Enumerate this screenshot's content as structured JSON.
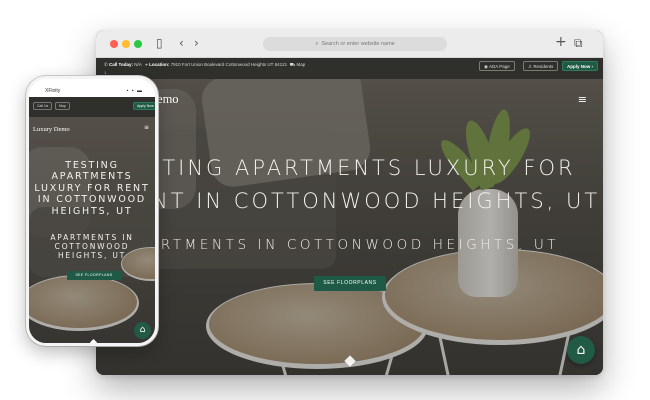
{
  "browser": {
    "url_placeholder": "Search or enter website name",
    "icons": {
      "sidebar": "sidebar-icon",
      "back": "chevron-left-icon",
      "forward": "chevron-right-icon",
      "new_tab": "plus-icon",
      "tabs": "tabs-icon",
      "search": "search-icon"
    }
  },
  "topbar": {
    "call_label": "Call Today:",
    "call_value": "N/A",
    "location_label": "Location:",
    "location_value": "7910 Fort Union Boulevard Cottonwood Heights UT 84121",
    "map_link": "Map",
    "sub_text": "1",
    "buttons": {
      "ada": "ADA Page",
      "residents": "Residents",
      "apply": "Apply Now"
    }
  },
  "site": {
    "logo": "Demo",
    "phone_logo": "Luxury Demo",
    "menu_icon": "≡",
    "title_line1": "STING APARTMENTS LUXURY FOR",
    "title_line2": "NT IN COTTONWOOD HEIGHTS, UT",
    "subtitle": "ARTMENTS IN COTTONWOOD HEIGHTS, UT",
    "cta": "SEE FLOORPLANS",
    "phone_title": "TESTING APARTMENTS LUXURY FOR RENT IN COTTONWOOD HEIGHTS, UT",
    "phone_subtitle": "APARTMENTS IN COTTONWOOD HEIGHTS, UT",
    "chat_icon": "chat-home-icon"
  },
  "phone": {
    "time": "XFinity",
    "battery": "▪ ▪ ▬",
    "btn_call": "Call Us",
    "btn_map": "Map",
    "btn_apply": "Apply Now"
  },
  "colors": {
    "accent": "#1e5a45",
    "topbar": "#2f2f2c"
  }
}
